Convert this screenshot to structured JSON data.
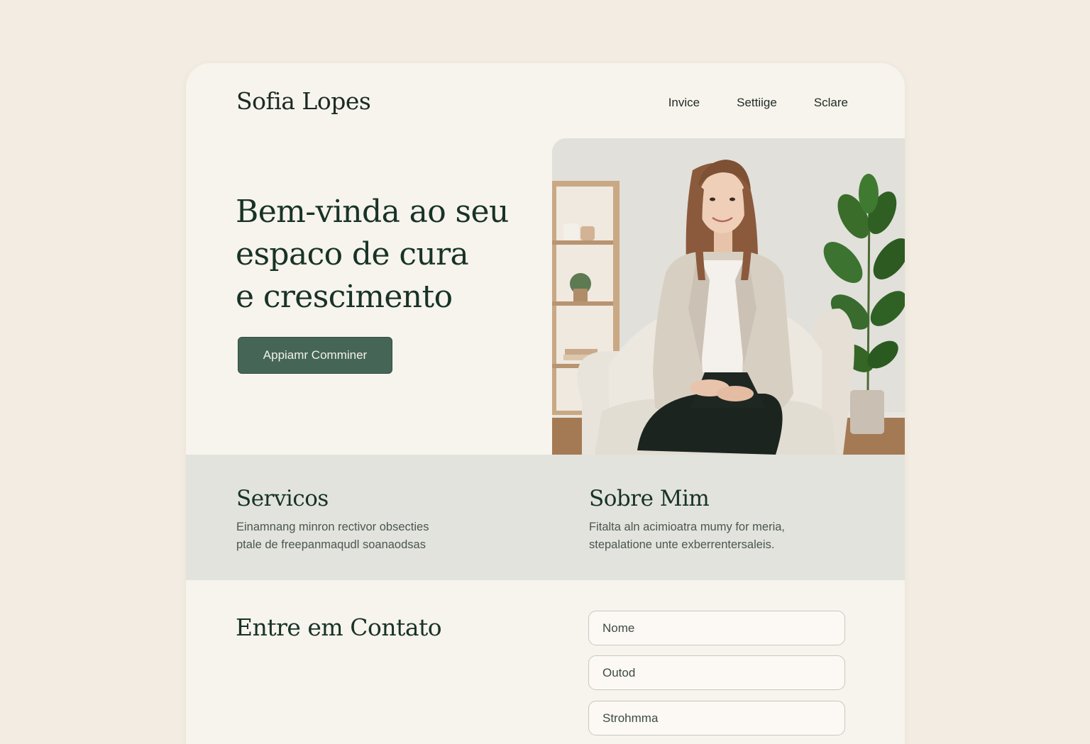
{
  "brand": {
    "name": "Sofia Lopes"
  },
  "nav": {
    "items": [
      "Invice",
      "Settiige",
      "Sclare"
    ]
  },
  "hero": {
    "title_lines": [
      "Bem-vinda ao seu",
      "espaco de cura",
      "e crescimento"
    ],
    "cta_label": "Appiamr Comminer"
  },
  "services": {
    "title": "Servicos",
    "lines": [
      "Einamnang minron rectivor obsecties",
      "ptale de freepanmaqudl soanaodsas"
    ]
  },
  "about": {
    "title": "Sobre Mim",
    "lines": [
      "Fitalta aln acimioatra mumy for meria,",
      "stepalatione unte exberrentersaleis."
    ]
  },
  "contact": {
    "title": "Entre em Contato",
    "fields": [
      "Nome",
      "Outod",
      "Strohmma"
    ]
  },
  "colors": {
    "page_bg": "#f3ece2",
    "card_bg": "#f7f3ed",
    "band_bg": "#e3e3dd",
    "accent_green": "#456656",
    "heading_text": "#173326"
  }
}
